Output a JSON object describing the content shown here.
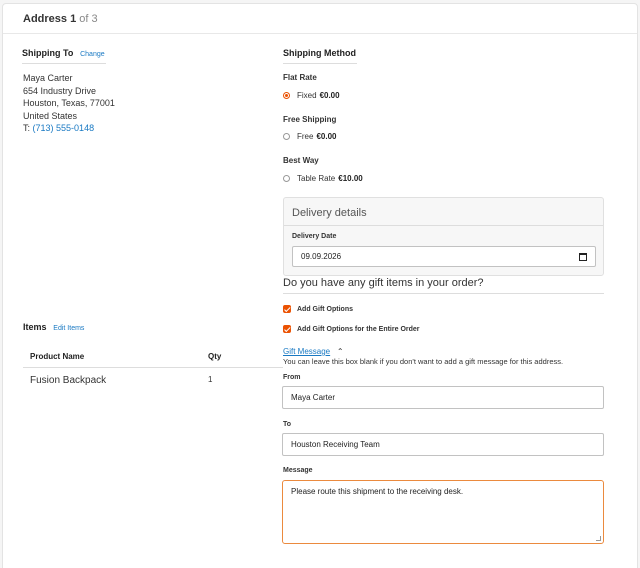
{
  "header": {
    "address_word": "Address",
    "address_index": "1",
    "address_of": "of 3"
  },
  "shipping_to": {
    "title": "Shipping To",
    "change_label": "Change",
    "lines": [
      "Maya Carter",
      "654 Industry Drive",
      "Houston, Texas, 77001",
      "United States"
    ],
    "phone_prefix": "T:",
    "phone": "(713) 555-0148"
  },
  "shipping_method": {
    "title": "Shipping Method",
    "groups": [
      {
        "title": "Flat Rate",
        "option": "Fixed",
        "price": "€0.00",
        "selected": true
      },
      {
        "title": "Free Shipping",
        "option": "Free",
        "price": "€0.00",
        "selected": false
      },
      {
        "title": "Best Way",
        "option": "Table Rate",
        "price": "€10.00",
        "selected": false
      }
    ]
  },
  "delivery": {
    "title": "Delivery details",
    "date_label": "Delivery Date",
    "date_value": "09.09.2026"
  },
  "gift": {
    "question": "Do you have any gift items in your order?",
    "add_gift_options": "Add Gift Options",
    "add_gift_options_order": "Add Gift Options for the Entire Order",
    "gift_message_link": "Gift Message",
    "note": "You can leave this box blank if you don't want to add a gift message for this address.",
    "from_label": "From",
    "from_value": "Maya Carter",
    "to_label": "To",
    "to_value": "Houston Receiving Team",
    "message_label": "Message",
    "message_value": "Please route this shipment to the receiving desk."
  },
  "items": {
    "title": "Items",
    "edit_label": "Edit Items",
    "columns": [
      "Product Name",
      "Qty"
    ],
    "rows": [
      {
        "name": "Fusion Backpack",
        "qty": "1"
      }
    ]
  },
  "colors": {
    "accent": "#eb5202",
    "link": "#1979c3"
  },
  "icons": {
    "calendar": "calendar-icon",
    "chevron": "chevron-up-icon"
  }
}
